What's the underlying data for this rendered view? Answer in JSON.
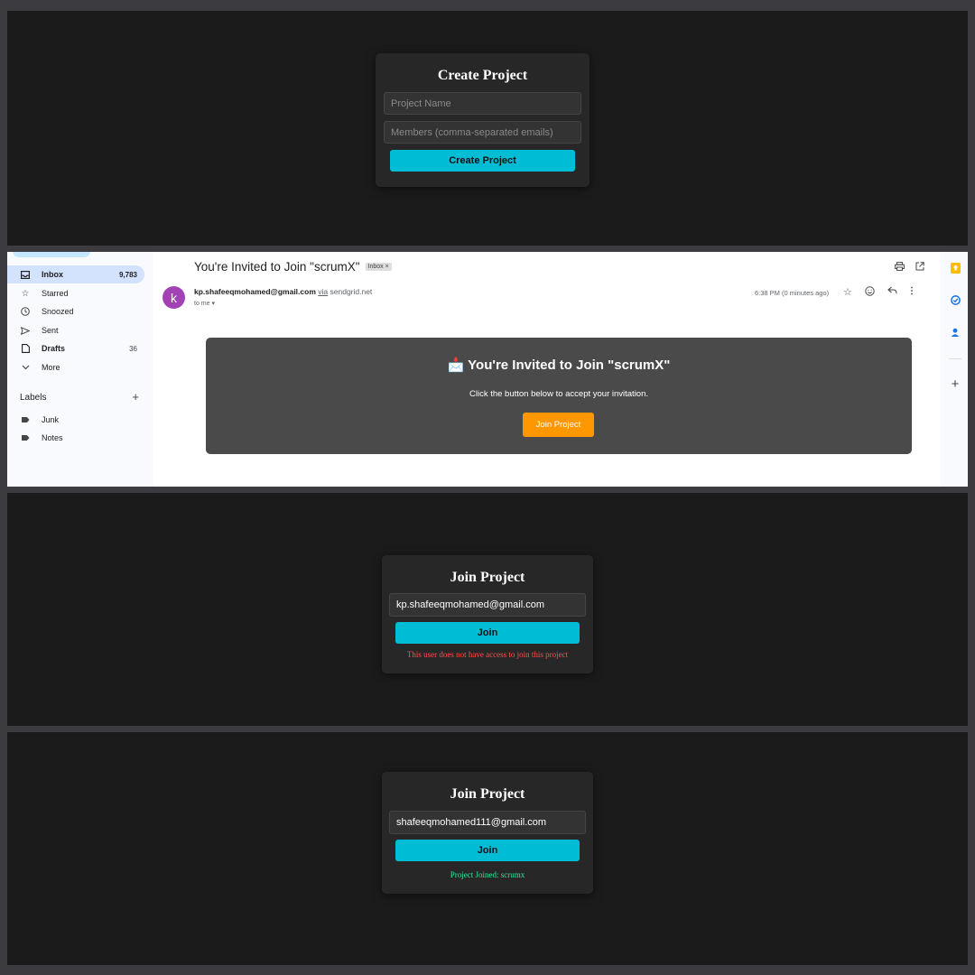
{
  "create_project": {
    "title": "Create Project",
    "project_name_placeholder": "Project Name",
    "members_placeholder": "Members (comma-separated emails)",
    "button": "Create Project"
  },
  "gmail": {
    "nav": [
      {
        "label": "Inbox",
        "count": "9,783",
        "icon": "inbox-icon"
      },
      {
        "label": "Starred",
        "count": "",
        "icon": "star-icon"
      },
      {
        "label": "Snoozed",
        "count": "",
        "icon": "clock-icon"
      },
      {
        "label": "Sent",
        "count": "",
        "icon": "send-icon"
      },
      {
        "label": "Drafts",
        "count": "36",
        "icon": "draft-icon"
      },
      {
        "label": "More",
        "count": "",
        "icon": "chevron-down-icon"
      }
    ],
    "labels_heading": "Labels",
    "labels": [
      "Junk",
      "Notes"
    ],
    "subject": "You're Invited to Join \"scrumX\"",
    "inbox_chip": "Inbox ×",
    "sender_email": "kp.shafeeqmohamed@gmail.com",
    "via_word": "via",
    "via_domain": "sendgrid.net",
    "recipient": "to me ▾",
    "avatar_letter": "k",
    "timestamp": "6:38 PM (0 minutes ago)",
    "email_body": {
      "title": "📩 You're Invited to Join \"scrumX\"",
      "text": "Click the button below to accept your invitation.",
      "button": "Join Project"
    },
    "accent_color": "#ff9800"
  },
  "join_attempt_1": {
    "title": "Join Project",
    "email_value": "kp.shafeeqmohamed@gmail.com",
    "button": "Join",
    "message": "This user does not have access to join this project",
    "message_color": "#ff4d4d"
  },
  "join_attempt_2": {
    "title": "Join Project",
    "email_value": "shafeeqmohamed111@gmail.com",
    "button": "Join",
    "message": "Project Joined: scrumx",
    "message_color": "#2ee89a"
  }
}
